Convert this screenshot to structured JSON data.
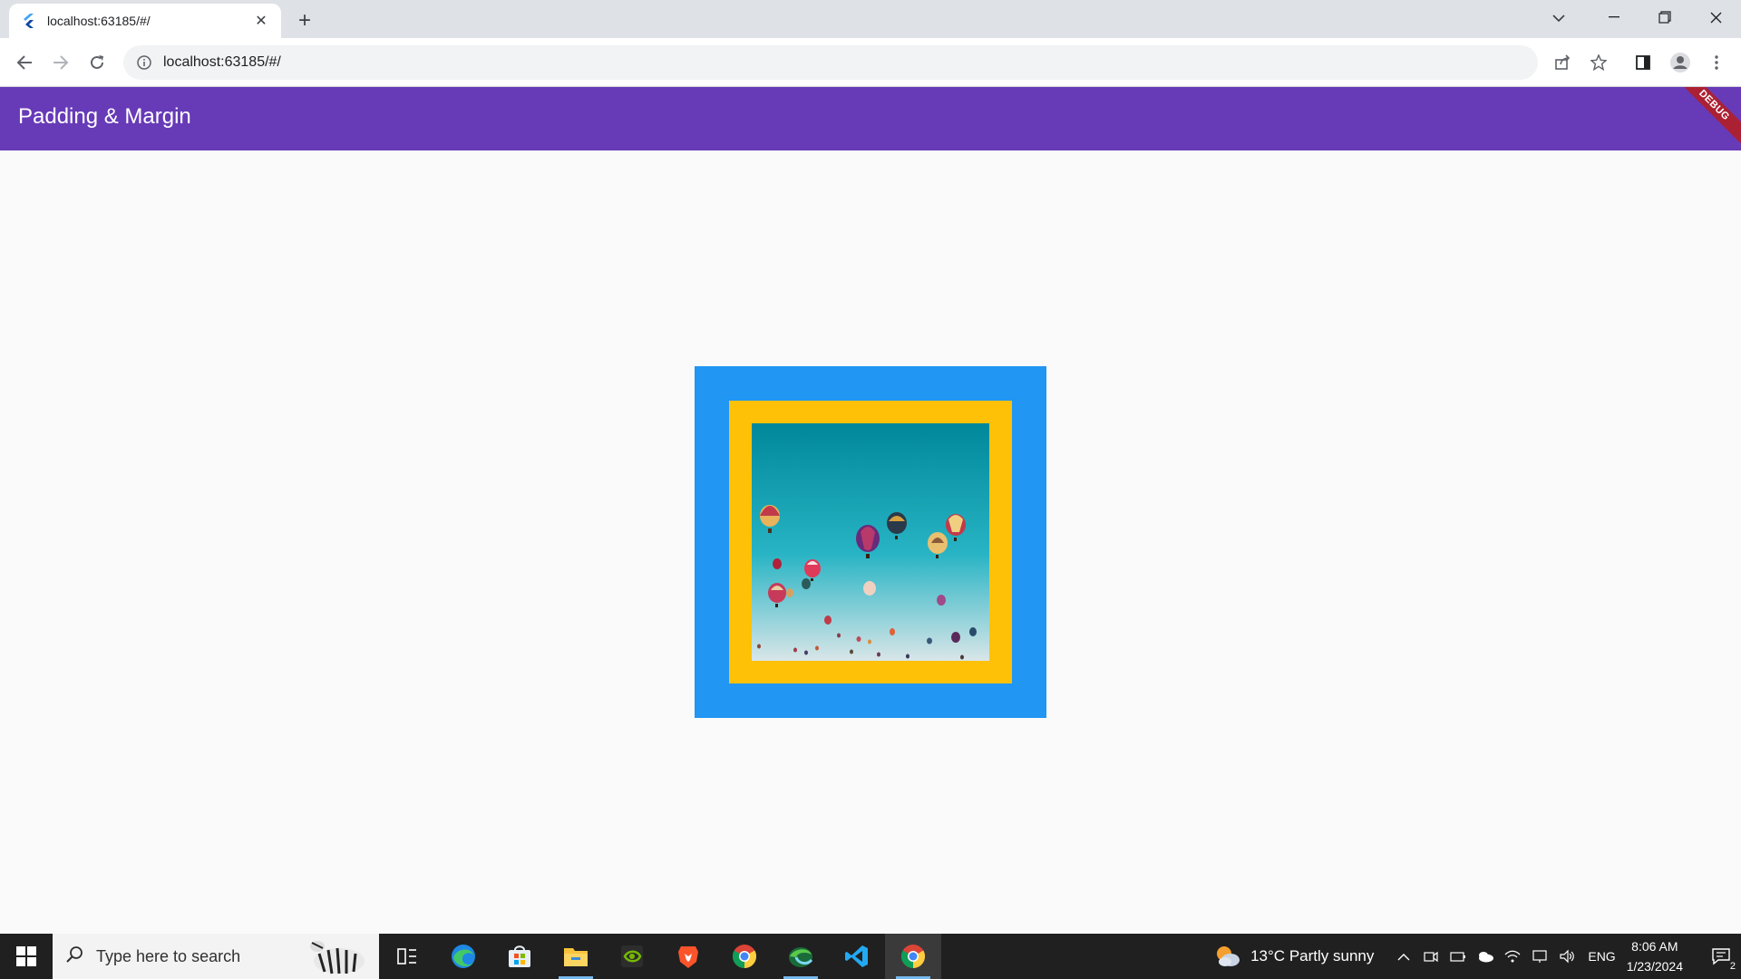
{
  "browser": {
    "tab_title": "localhost:63185/#/",
    "url": "localhost:63185/#/",
    "favicon": "flutter-icon",
    "icons": [
      "back-arrow-icon",
      "forward-arrow-icon",
      "reload-icon",
      "info-icon",
      "share-icon",
      "star-icon",
      "side-panel-icon",
      "profile-icon",
      "more-vert-icon",
      "tab-search-icon",
      "minimize-icon",
      "maximize-icon",
      "close-icon",
      "new-tab-icon"
    ]
  },
  "app": {
    "title": "Padding & Margin",
    "debug_label": "DEBUG",
    "colors": {
      "appbar": "#673ab7",
      "outer_box": "#2196f3",
      "inner_box": "#ffc107",
      "background": "#fafafa"
    },
    "image": "hot-air-balloons-photo"
  },
  "taskbar": {
    "search_placeholder": "Type here to search",
    "apps": [
      "task-view-icon",
      "edge-icon",
      "store-icon",
      "file-explorer-icon",
      "nvidia-icon",
      "brave-icon",
      "chrome-icon",
      "edge-dev-icon",
      "vscode-icon",
      "chrome-active-icon"
    ],
    "weather": {
      "temp": "13°C",
      "condition": "Partly sunny"
    },
    "language": "ENG",
    "time": "8:06 AM",
    "date": "1/23/2024",
    "notification_count": "2"
  }
}
